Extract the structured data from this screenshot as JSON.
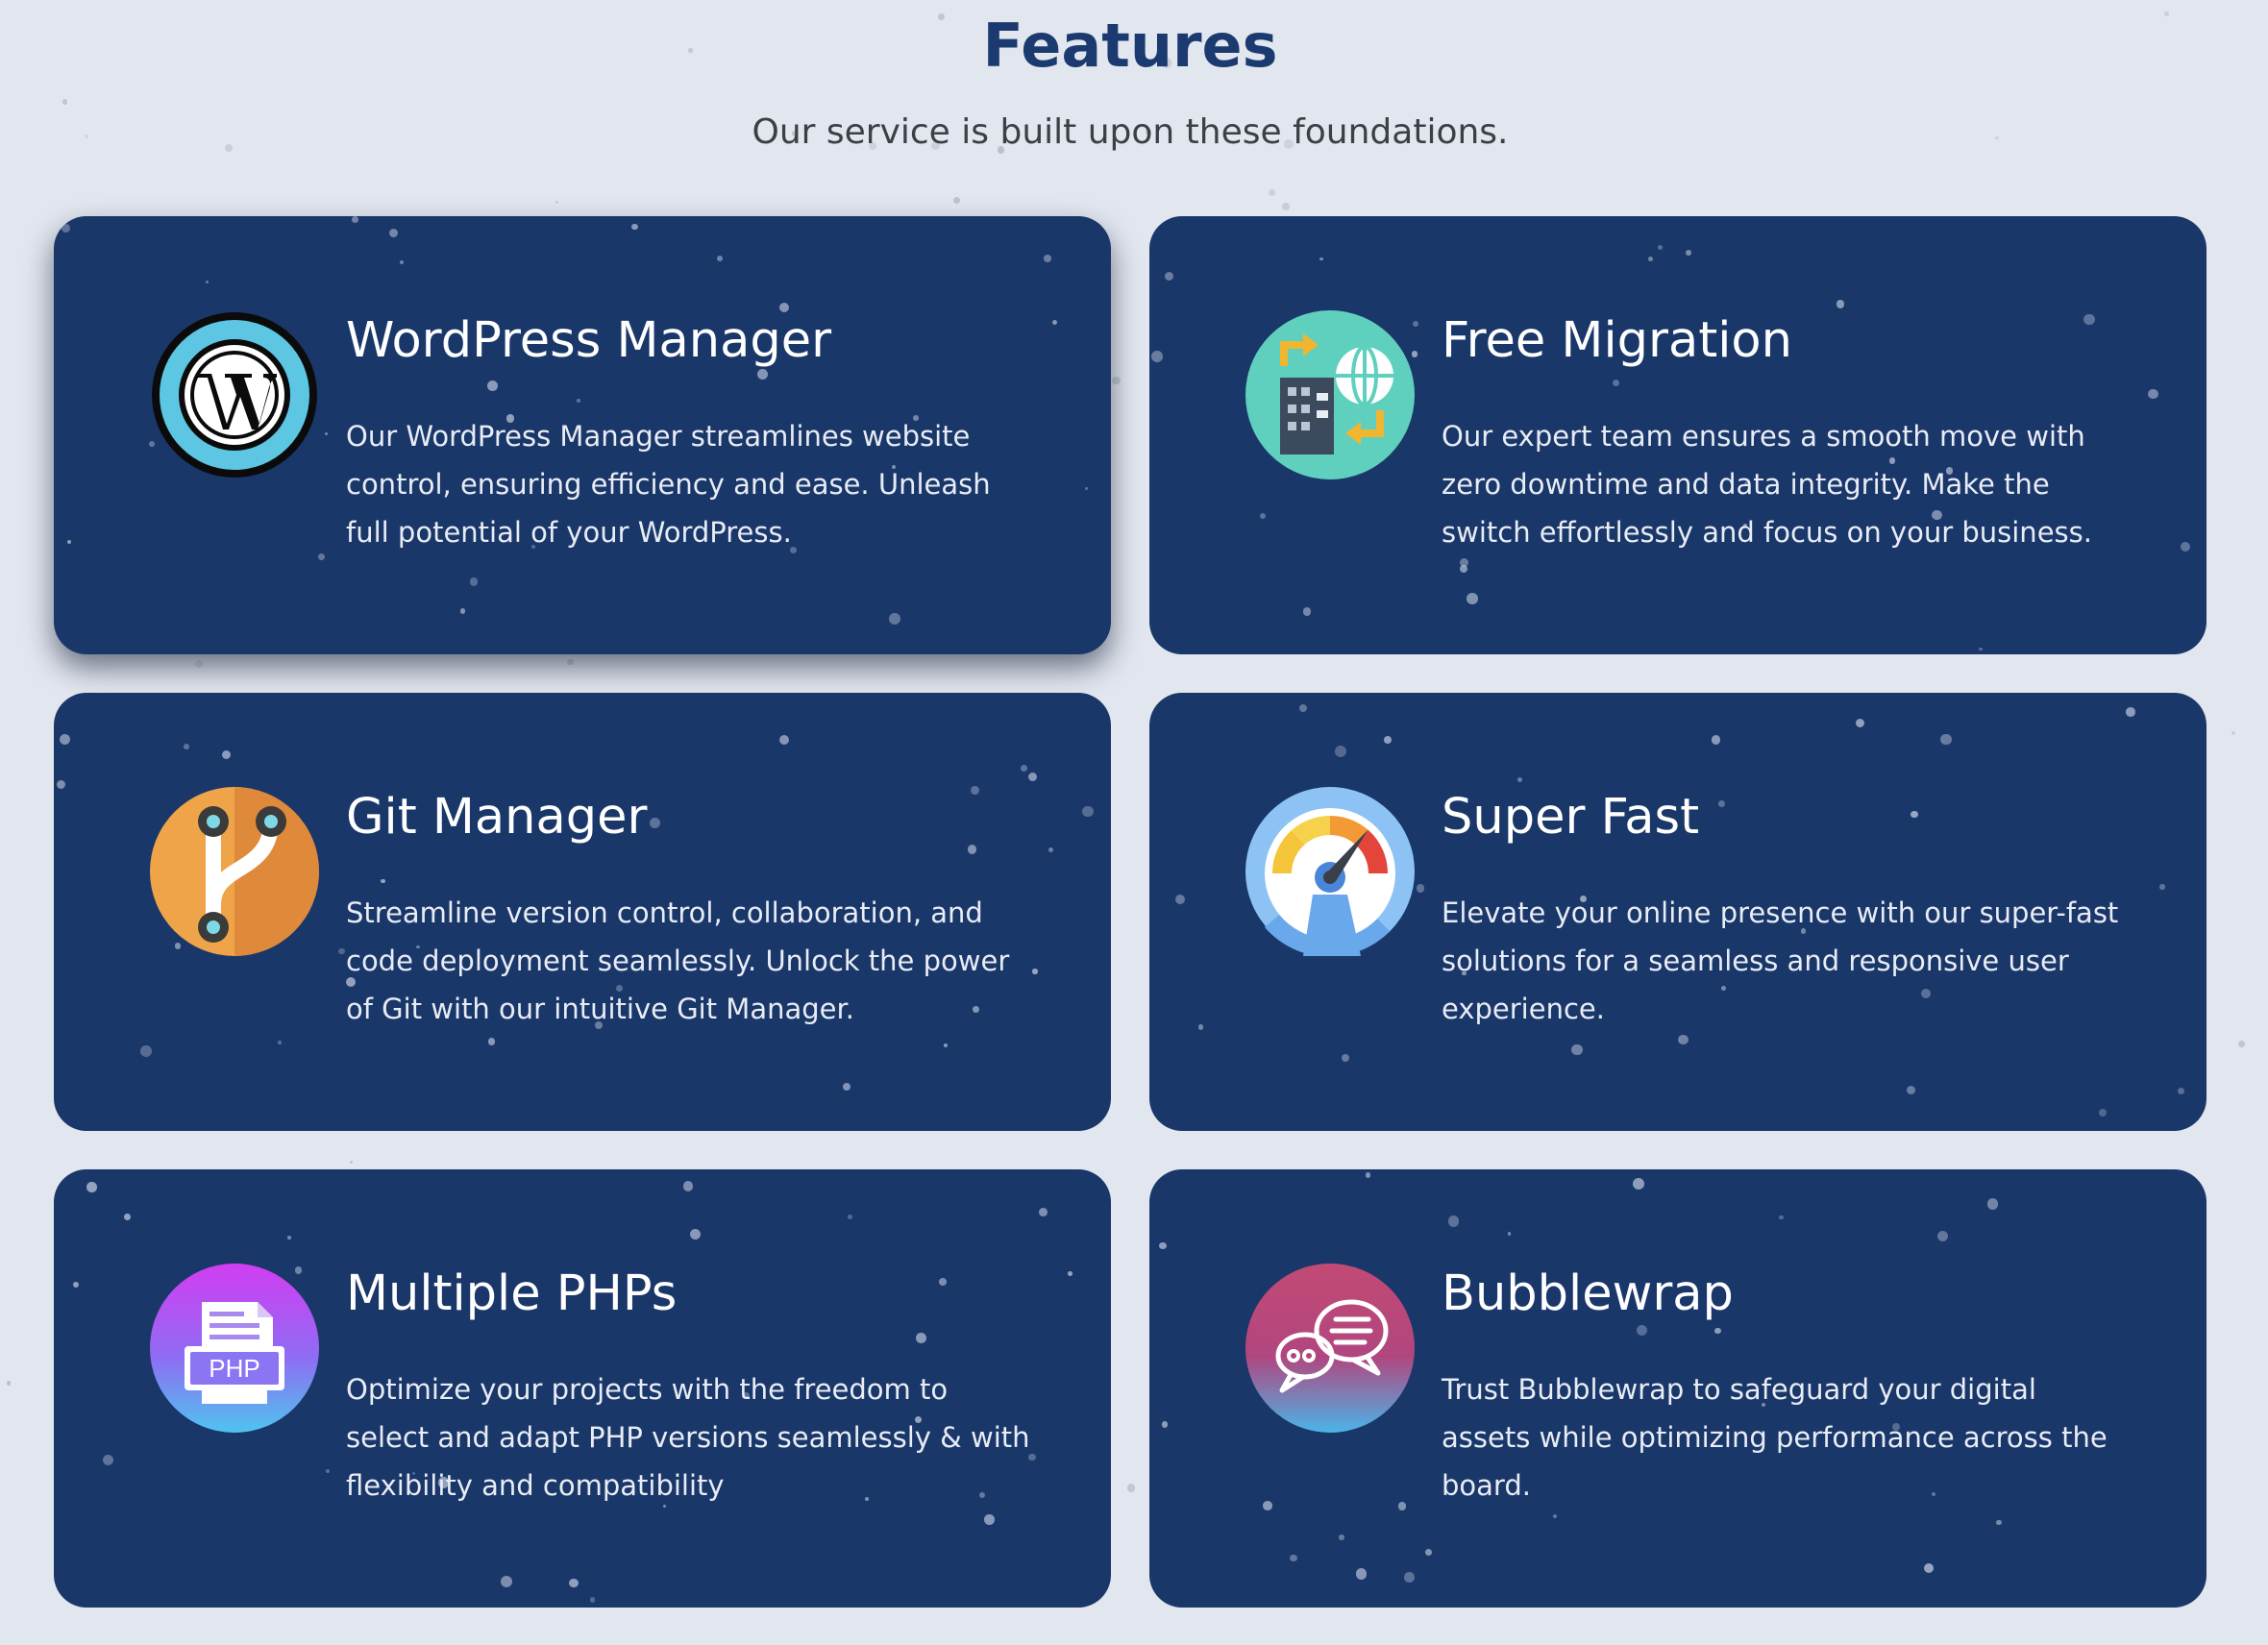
{
  "header": {
    "title": "Features",
    "subtitle": "Our service is built upon these foundations."
  },
  "colors": {
    "page_background": "#e2e6ee",
    "card_background": "#1a376a",
    "title_color": "#1b3a70"
  },
  "features": [
    {
      "title": "WordPress Manager",
      "description": "Our WordPress Manager streamlines website control, ensuring efficiency and ease. Unleash full potential of your WordPress.",
      "icon": "wordpress-icon"
    },
    {
      "title": "Free Migration",
      "description": "Our expert team ensures a smooth move with zero downtime and data integrity. Make the switch effortlessly and focus on your business.",
      "icon": "migration-icon"
    },
    {
      "title": "Git Manager",
      "description": "Streamline version control, collaboration, and code deployment seamlessly. Unlock the power of Git with our intuitive Git Manager.",
      "icon": "git-branch-icon"
    },
    {
      "title": "Super Fast",
      "description": "Elevate your online presence with our super-fast solutions for a seamless and responsive user experience.",
      "icon": "speedometer-icon"
    },
    {
      "title": "Multiple PHPs",
      "description": "Optimize your projects with the freedom to select and adapt PHP versions seamlessly & with flexibility and compatibility",
      "icon": "php-file-icon",
      "icon_label": "PHP"
    },
    {
      "title": "Bubblewrap",
      "description": "Trust Bubblewrap to safeguard your digital assets while optimizing performance across the board.",
      "icon": "chat-bubbles-icon"
    }
  ]
}
